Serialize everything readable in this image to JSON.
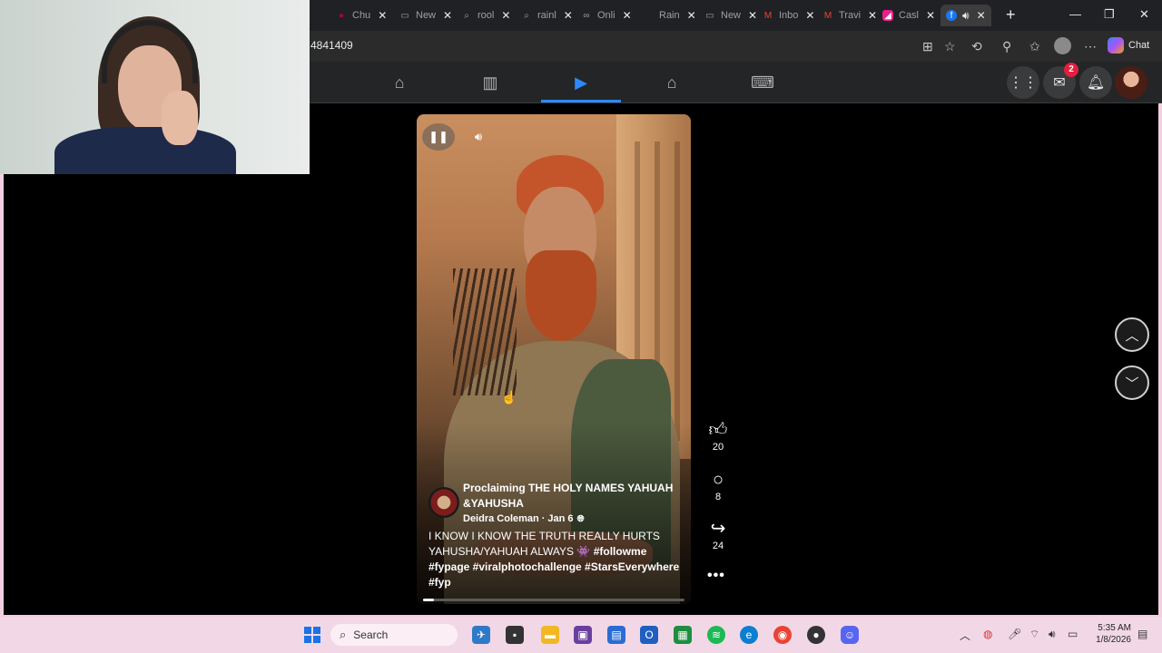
{
  "browser": {
    "tabs": [
      {
        "label": "Chu",
        "icon": "chrome-tab-icon"
      },
      {
        "label": "New",
        "icon": "newtab-icon"
      },
      {
        "label": "rool",
        "icon": "search-tab-icon"
      },
      {
        "label": "rainl",
        "icon": "search-tab-icon"
      },
      {
        "label": "Onli",
        "icon": "link-tab-icon"
      },
      {
        "label": "Rain",
        "icon": "tab-icon"
      },
      {
        "label": "New",
        "icon": "newtab-icon"
      },
      {
        "label": "Inbo",
        "icon": "gmail-icon"
      },
      {
        "label": "Travi",
        "icon": "gmail-icon"
      },
      {
        "label": "Casl",
        "icon": "app-icon"
      }
    ],
    "url_fragment": "4841409",
    "chat_label": "Chat"
  },
  "fb": {
    "notification_count": "2"
  },
  "reel": {
    "title": "Proclaiming THE HOLY NAMES YAHUAH &YAHUSHA",
    "author": "Deidra Coleman",
    "date": "Jan 6",
    "separator": "·",
    "caption_text": "I KNOW I KNOW THE TRUTH REALLY HURTS YAHUSHA/YAHUAH  ALWAYS",
    "emoji": "👾",
    "hashtags": "#followme #fypage #viralphotochallenge #StarsEverywhere #fyp",
    "progress": 0.04,
    "likes": "20",
    "comments": "8",
    "shares": "24"
  },
  "taskbar": {
    "search_label": "Search",
    "time": "5:35 AM",
    "date": "1/8/2026"
  }
}
